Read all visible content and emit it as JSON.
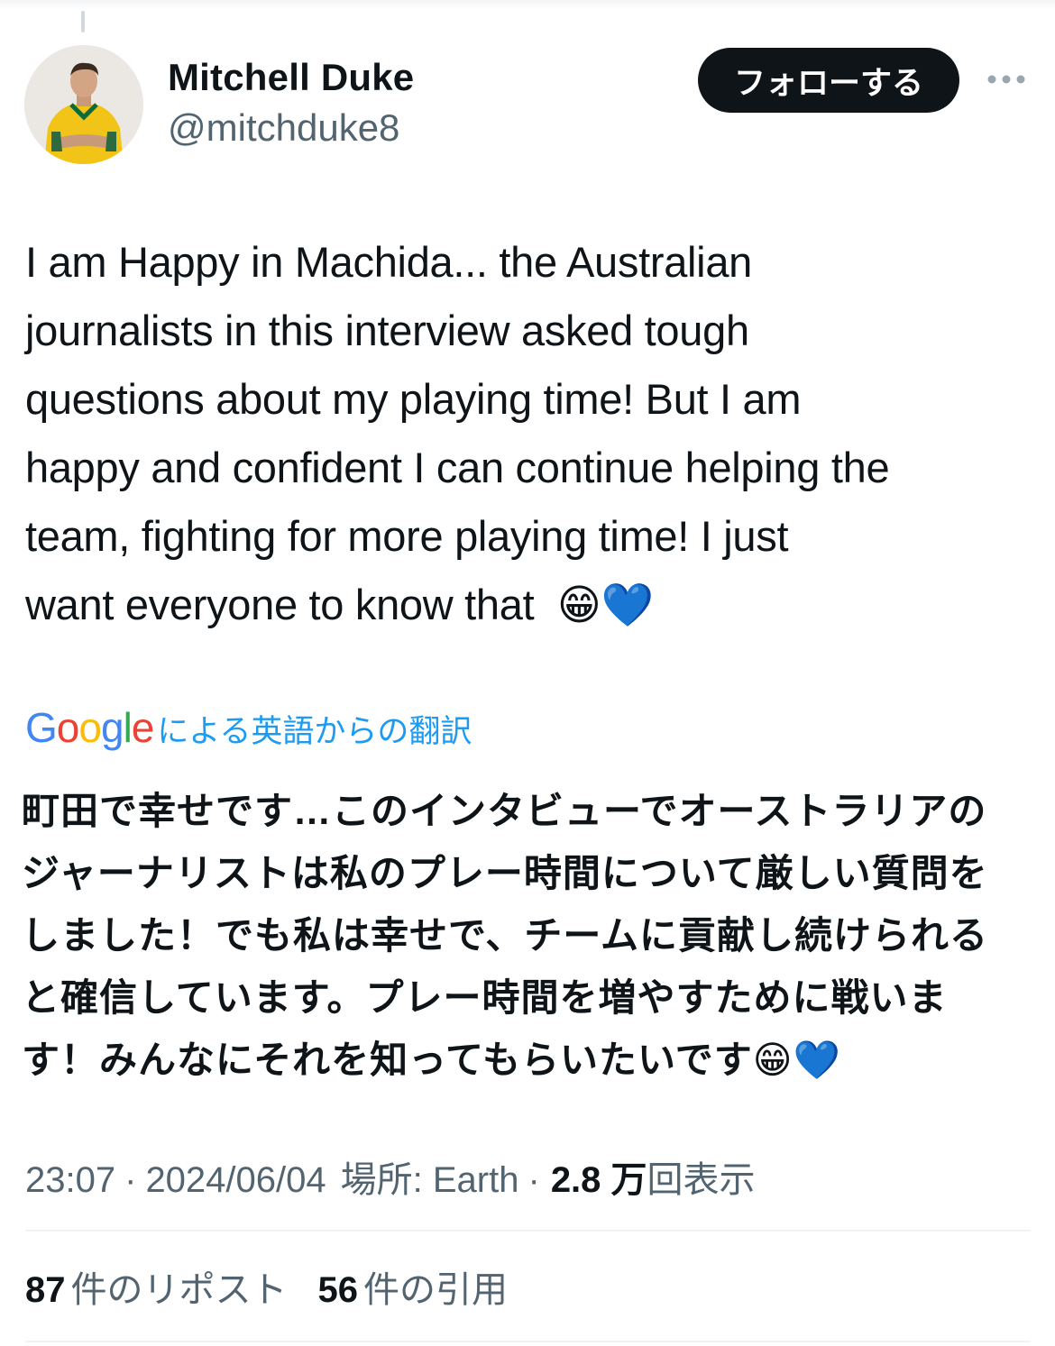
{
  "author": {
    "display_name": "Mitchell Duke",
    "handle": "@mitchduke8",
    "avatar_icon": "user-avatar-photo"
  },
  "actions": {
    "follow_label": "フォローする",
    "more_icon": "more-horizontal-icon"
  },
  "tweet": {
    "text": "I am Happy in Machida... the Australian\njournalists in this interview asked tough\nquestions about my playing time! But I am\nhappy and confident I can continue helping the\nteam, fighting for more playing time! I just\nwant everyone to know that  😁💙"
  },
  "translation": {
    "provider": "Google",
    "label": "による英語からの翻訳",
    "text": "町田で幸せです…このインタビューでオーストラリアのジャーナリストは私のプレー時間について厳しい質問をしました！でも私は幸せで、チームに貢献し続けられると確信しています。プレー時間を増やすために戦います！みんなにそれを知ってもらいたいです😁💙"
  },
  "meta": {
    "time": "23:07",
    "separator": "·",
    "date": "2024/06/04",
    "location": "場所: Earth",
    "views_count": "2.8 万",
    "views_label": "回表示"
  },
  "stats": {
    "reposts_count": "87",
    "reposts_label": "件のリポスト",
    "quotes_count": "56",
    "quotes_label": "件の引用"
  },
  "colors": {
    "text": "#0f1419",
    "secondary": "#536471",
    "link": "#1d9bf0",
    "follow_bg": "#0f1419"
  }
}
